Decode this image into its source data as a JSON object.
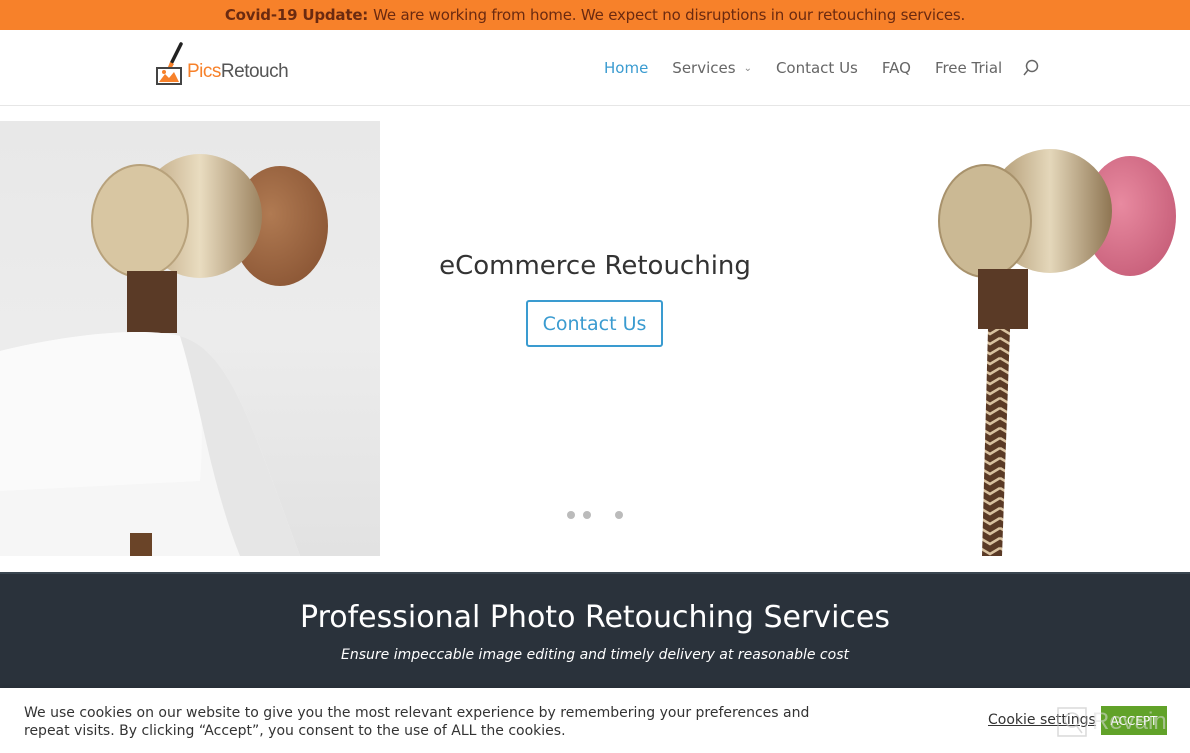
{
  "announcement": {
    "label": "Covid-19 Update:",
    "text": "We are working from home. We expect no disruptions in our retouching services."
  },
  "brand": {
    "name_part1": "Pics",
    "name_part2": "Retouch",
    "accent": "#f7812a"
  },
  "nav": {
    "items": [
      {
        "label": "Home",
        "active": true
      },
      {
        "label": "Services",
        "has_dropdown": true
      },
      {
        "label": "Contact Us"
      },
      {
        "label": "FAQ"
      },
      {
        "label": "Free Trial"
      }
    ],
    "search_icon": "search-icon",
    "active_color": "#3a9bd0"
  },
  "hero": {
    "title": "eCommerce Retouching",
    "button_label": "Contact Us",
    "slides_count": 4,
    "active_slide": 3,
    "left_image": "earphone-brown-tip-on-cloth",
    "right_image": "earphone-pink-tip-braided-cable"
  },
  "band": {
    "title": "Professional Photo Retouching Services",
    "subtitle": "Ensure impeccable image editing and timely delivery at reasonable cost",
    "background": "#2a323b"
  },
  "cookie_banner": {
    "message": "We use cookies on our website to give you the most relevant experience by remembering your preferences and repeat visits. By clicking “Accept”, you consent to the use of ALL the cookies.",
    "settings_label": "Cookie settings",
    "accept_label": "ACCEPT",
    "accept_color": "#61a229"
  },
  "watermark": {
    "text": "Revain"
  }
}
